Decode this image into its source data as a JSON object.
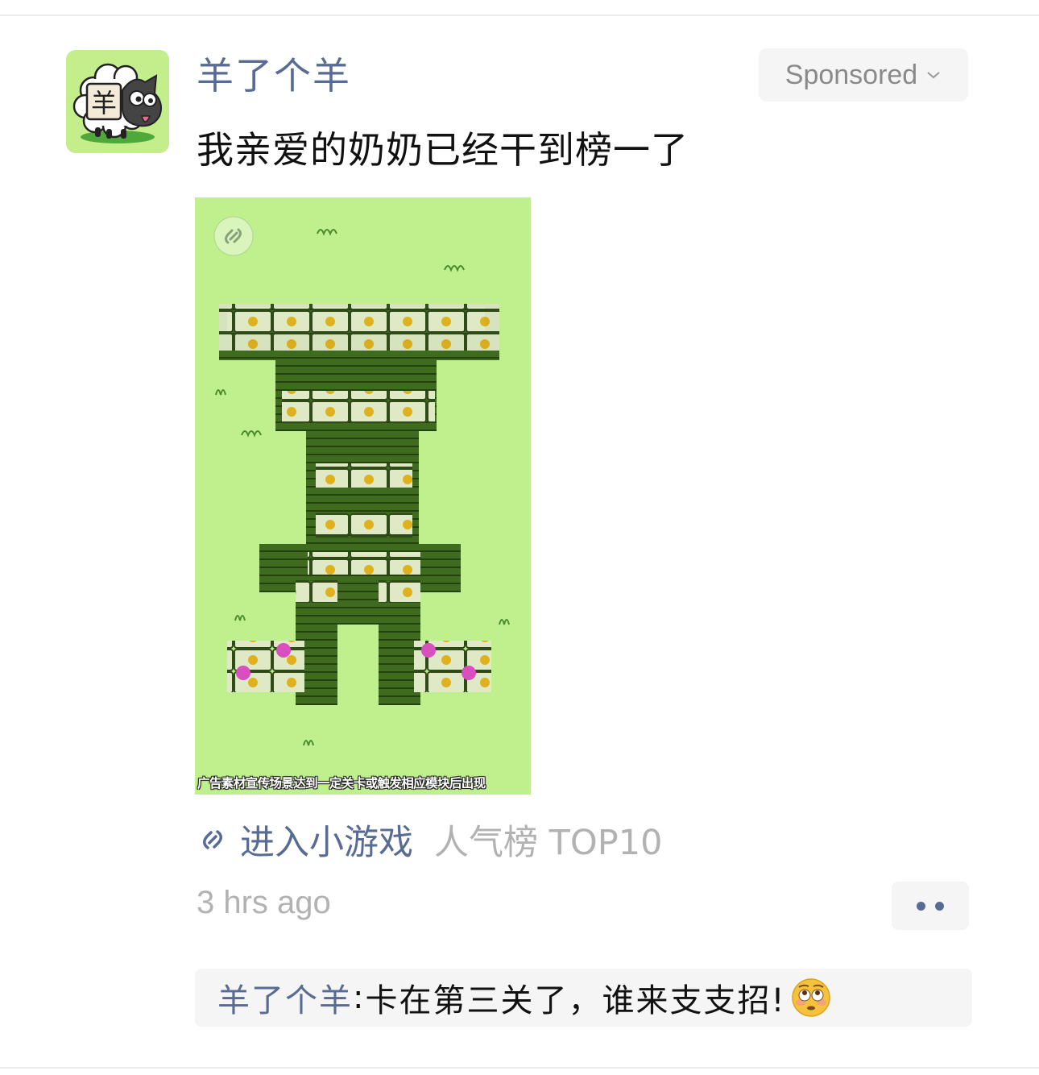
{
  "post": {
    "account_name": "羊了个羊",
    "sponsored_label": "Sponsored",
    "text": "我亲爱的奶奶已经干到榜一了",
    "media_caption": "广告素材宣传场景达到一定关卡或触发相应模块后出现",
    "mini_game_link": "进入小游戏",
    "rank_label": "人气榜 TOP10",
    "time_ago": "3 hrs ago",
    "avatar_char": "羊"
  },
  "comment": {
    "author": "羊了个羊",
    "separator": ": ",
    "text": "卡在第三关了，谁来支支招!",
    "emoji": "flushed-face-emoji"
  },
  "colors": {
    "link_blue": "#576b95",
    "media_bg": "#bff08d",
    "gray_text": "#b2b2b2",
    "panel_bg": "#f5f5f5"
  }
}
